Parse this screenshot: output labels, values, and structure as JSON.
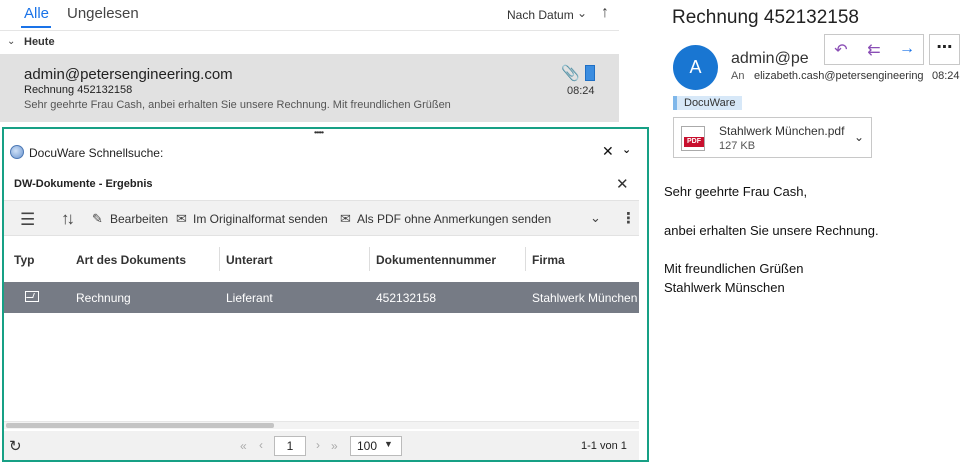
{
  "mail_list": {
    "tabs": [
      "Alle",
      "Ungelesen"
    ],
    "sort_label": "Nach Datum",
    "group_label": "Heute",
    "item": {
      "sender": "admin@petersengineering.com",
      "subject": "Rechnung 452132158",
      "preview": "Sehr geehrte Frau Cash,   anbei erhalten Sie unsere Rechnung.   Mit freundlichen Grüßen",
      "time": "08:24"
    }
  },
  "docuware": {
    "title": "DocuWare Schnellsuche:",
    "subtitle": "DW-Dokumente - Ergebnis",
    "toolbar": {
      "edit": "Bearbeiten",
      "send_original": "Im Originalformat senden",
      "send_pdf": "Als PDF ohne Anmerkungen senden"
    },
    "columns": [
      "Typ",
      "Art des Dokuments",
      "Unterart",
      "Dokumentennummer",
      "Firma"
    ],
    "rows": [
      {
        "art": "Rechnung",
        "unterart": "Lieferant",
        "nummer": "452132158",
        "firma": "Stahlwerk München"
      }
    ],
    "pager": {
      "page": "1",
      "page_size": "100",
      "count": "1-1 von 1"
    }
  },
  "reading_pane": {
    "title": "Rechnung 452132158",
    "avatar_initial": "A",
    "sender": "admin@pe",
    "to_label": "An",
    "to": "elizabeth.cash@petersengineering",
    "time": "08:24",
    "category": "DocuWare",
    "attachment": {
      "name": "Stahlwerk München.pdf",
      "size": "127 KB",
      "badge": "PDF"
    },
    "body": [
      "Sehr geehrte Frau Cash,",
      "anbei erhalten Sie unsere Rechnung.",
      "Mit freundlichen Grüßen",
      "Stahlwerk Münschen"
    ]
  },
  "colors": {
    "accent": "#1a73e8",
    "frame": "#17a085",
    "selected_row": "#767b85",
    "avatar": "#1976d2"
  },
  "icons": [
    "chevron-down-icon",
    "sort-arrow-icon",
    "paperclip-icon",
    "flag-icon",
    "globe-icon",
    "close-icon",
    "collapse-icon",
    "list-view-icon",
    "sort-icon",
    "pencil-icon",
    "mail-icon",
    "more-icon",
    "refresh-icon",
    "reply-icon",
    "reply-all-icon",
    "forward-icon",
    "pdf-icon"
  ]
}
